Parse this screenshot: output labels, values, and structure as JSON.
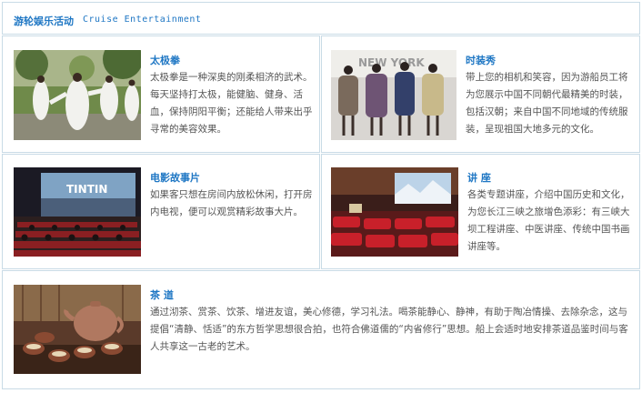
{
  "header": {
    "title_cn": "游轮娱乐活动",
    "title_en": "Cruise Entertainment"
  },
  "cards": {
    "taiji": {
      "title": "太极拳",
      "text": "太极拳是一种深奥的刚柔相济的武术。每天坚持打太极，能健脑、健身、活血，保持阴阳平衡；还能给人带来出乎寻常的美容效果。",
      "image_icon": "tai-chi-photo"
    },
    "fashion": {
      "title": "时装秀",
      "text": "带上您的相机和笑容，因为游船员工将为您展示中国不同朝代最精美的时装，包括汉朝；来自中国不同地域的传统服装，呈现祖国大地多元的文化。",
      "image_icon": "fashion-show-photo",
      "image_sign": "NEW YORK"
    },
    "movie": {
      "title": "电影故事片",
      "text": "如果客只想在房间内放松休闲，打开房内电视，便可以观赏精彩故事大片。",
      "image_icon": "cinema-photo",
      "screen_text": "TINTIN"
    },
    "lecture": {
      "title": "讲 座",
      "text": "各类专题讲座，介绍中国历史和文化，为您长江三峡之旅增色添彩：有三峡大坝工程讲座、中医讲座、传统中国书画讲座等。",
      "image_icon": "lecture-hall-photo"
    },
    "tea": {
      "title": "茶 道",
      "text": "通过沏茶、赏茶、饮茶、增进友谊，美心修德，学习礼法。喝茶能静心、静神，有助于陶冶情操、去除杂念，这与提倡“清静、恬适”的东方哲学思想很合拍，也符合佛道儒的“内省修行”思想。船上会适时地安排茶道品鉴时间与客人共享这一古老的艺术。",
      "image_icon": "tea-set-photo"
    }
  },
  "colors": {
    "accent": "#1f77c4",
    "border": "#c9dbe6",
    "body_text": "#555555"
  }
}
